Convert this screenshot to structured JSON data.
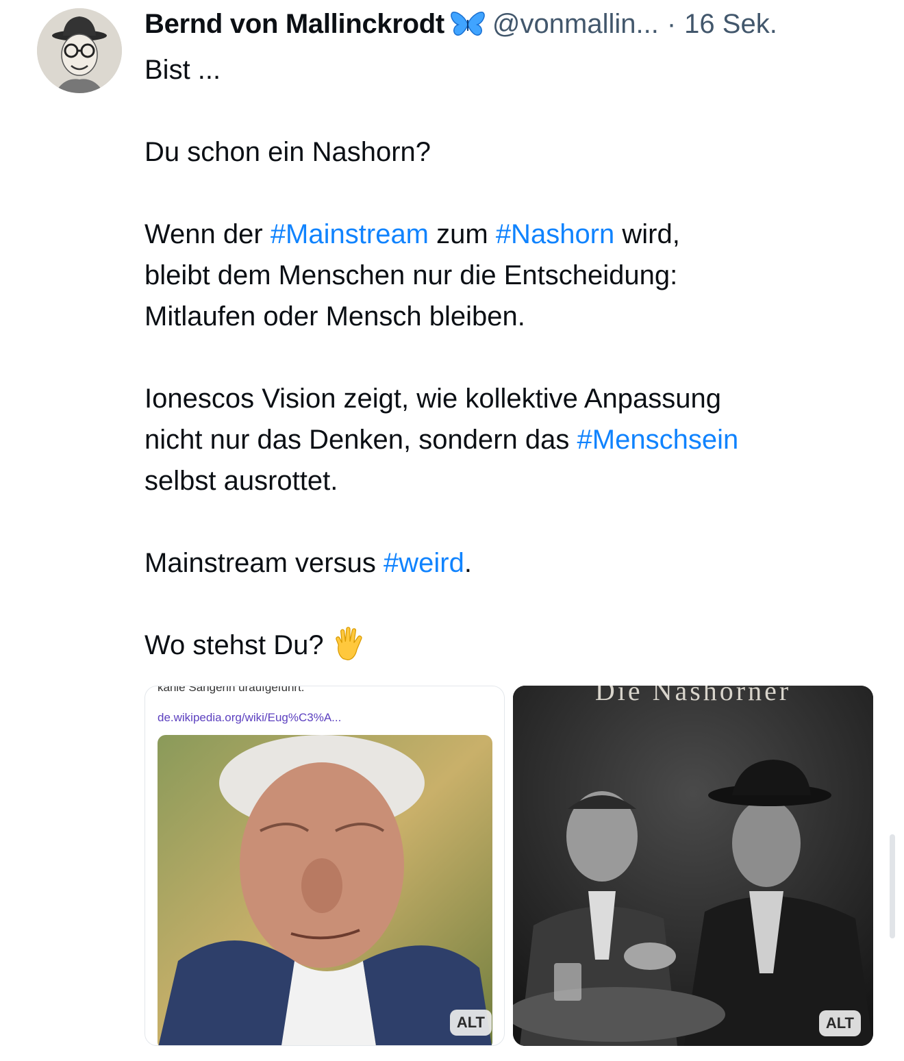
{
  "post": {
    "author_name": "Bernd von Mallinckrodt",
    "author_badge_icon": "butterfly-icon",
    "handle": "@vonmallin...",
    "separator": "·",
    "timestamp": "16 Sek.",
    "line1": "Bist ...",
    "line2": "Du schon ein Nashorn?",
    "p3_a": "Wenn der ",
    "p3_tag1": "#Mainstream",
    "p3_b": " zum ",
    "p3_tag2": "#Nashorn",
    "p3_c": " wird,",
    "p3_line2": "bleibt dem Menschen nur die Entscheidung:",
    "p3_line3": "Mitlaufen oder Mensch bleiben.",
    "p4_line1": "Ionescos Vision zeigt, wie kollektive Anpassung",
    "p4_line2_a": "nicht nur das Denken, sondern das ",
    "p4_tag": "#Menschsein",
    "p4_line3": "selbst ausrottet.",
    "p5_a": "Mainstream versus ",
    "p5_tag": "#weird",
    "p5_b": ".",
    "p6": "Wo stehst Du?",
    "emoji": "vulcan-salute"
  },
  "media": {
    "left": {
      "snippet_text": "kahle Sängerin uraufgeführt.",
      "snippet_link": "de.wikipedia.org/wiki/Eug%C3%A...",
      "alt_label": "ALT"
    },
    "right": {
      "title_text": "Die Nashörner",
      "alt_label": "ALT"
    }
  },
  "colors": {
    "hashtag": "#1083fe",
    "meta": "#42576c",
    "text": "#0b0f14"
  }
}
